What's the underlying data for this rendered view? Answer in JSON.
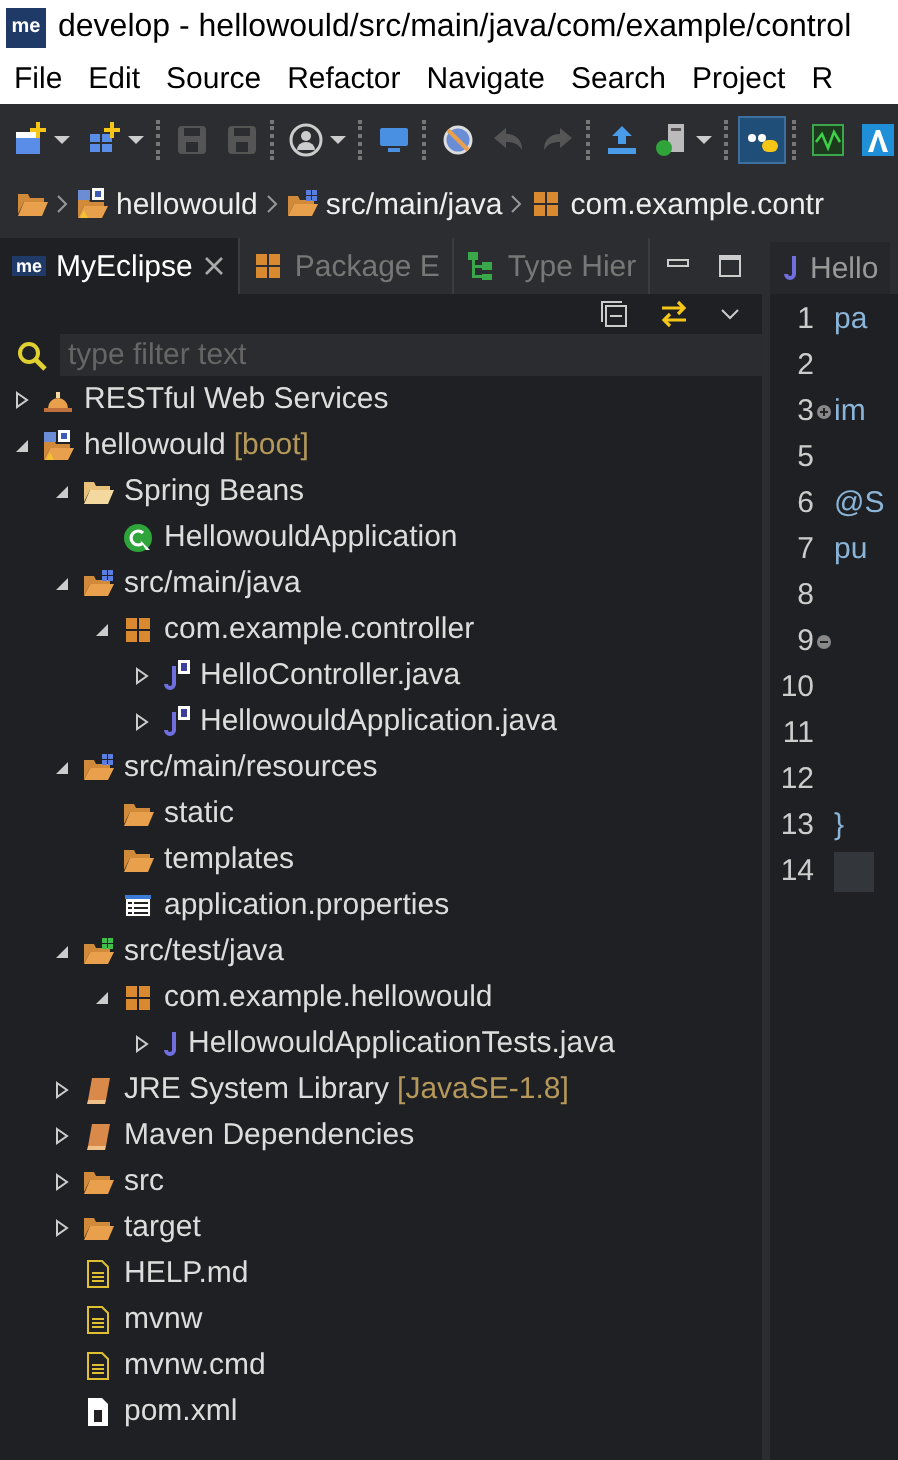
{
  "window": {
    "logo": "me",
    "title": "develop - hellowould/src/main/java/com/example/control"
  },
  "menu_bar": [
    "File",
    "Edit",
    "Source",
    "Refactor",
    "Navigate",
    "Search",
    "Project",
    "R"
  ],
  "toolbar": [
    {
      "kind": "new",
      "dropdown": true
    },
    {
      "kind": "new-class",
      "dropdown": true
    },
    {
      "kind": "sep"
    },
    {
      "kind": "save",
      "disabled": true
    },
    {
      "kind": "save-all",
      "disabled": true
    },
    {
      "kind": "sep"
    },
    {
      "kind": "user",
      "dropdown": true
    },
    {
      "kind": "sep"
    },
    {
      "kind": "monitor"
    },
    {
      "kind": "sep"
    },
    {
      "kind": "no-entry"
    },
    {
      "kind": "undo",
      "disabled": true
    },
    {
      "kind": "redo",
      "disabled": true
    },
    {
      "kind": "sep"
    },
    {
      "kind": "upload"
    },
    {
      "kind": "server",
      "dropdown": true
    },
    {
      "kind": "sep"
    },
    {
      "kind": "toggle",
      "selected": true
    },
    {
      "kind": "sep"
    },
    {
      "kind": "chart"
    },
    {
      "kind": "font"
    }
  ],
  "breadcrumb": [
    {
      "kind": "folder"
    },
    {
      "kind": "project",
      "label": "hellowould"
    },
    {
      "kind": "source-folder",
      "label": "src/main/java"
    },
    {
      "kind": "package",
      "label": "com.example.contr"
    }
  ],
  "views": {
    "tabs": [
      {
        "logo": "me",
        "label": "MyEclipse",
        "selected": true,
        "closable": true
      },
      {
        "kind": "package",
        "label": "Package E",
        "selected": false
      },
      {
        "kind": "hierarchy",
        "label": "Type Hier",
        "selected": false
      }
    ]
  },
  "filter": {
    "placeholder": "type filter text"
  },
  "tree": [
    {
      "kind": "service",
      "label": "RESTful Web Services",
      "expanded": false
    },
    {
      "kind": "project",
      "label": "hellowould",
      "decoration": "[boot]",
      "expanded": true,
      "children": [
        {
          "kind": "beans",
          "label": "Spring Beans",
          "expanded": true,
          "children": [
            {
              "kind": "spring-class",
              "label": "HellowouldApplication"
            }
          ]
        },
        {
          "kind": "source-folder",
          "label": "src/main/java",
          "expanded": true,
          "children": [
            {
              "kind": "package",
              "label": "com.example.controller",
              "expanded": true,
              "children": [
                {
                  "kind": "java-spring",
                  "label": "HelloController.java",
                  "expanded": false
                },
                {
                  "kind": "java-spring",
                  "label": "HellowouldApplication.java",
                  "expanded": false
                }
              ]
            }
          ]
        },
        {
          "kind": "source-folder",
          "label": "src/main/resources",
          "expanded": true,
          "children": [
            {
              "kind": "folder",
              "label": "static"
            },
            {
              "kind": "folder",
              "label": "templates"
            },
            {
              "kind": "properties",
              "label": "application.properties"
            }
          ]
        },
        {
          "kind": "test-folder",
          "label": "src/test/java",
          "expanded": true,
          "children": [
            {
              "kind": "package",
              "label": "com.example.hellowould",
              "expanded": true,
              "children": [
                {
                  "kind": "java",
                  "label": "HellowouldApplicationTests.java",
                  "expanded": false
                }
              ]
            }
          ]
        },
        {
          "kind": "library",
          "label": "JRE System Library",
          "decoration": "[JavaSE-1.8]",
          "expanded": false
        },
        {
          "kind": "library",
          "label": "Maven Dependencies",
          "expanded": false
        },
        {
          "kind": "folder",
          "label": "src",
          "expanded": false
        },
        {
          "kind": "folder",
          "label": "target",
          "expanded": false
        },
        {
          "kind": "text-file",
          "label": "HELP.md"
        },
        {
          "kind": "text-file",
          "label": "mvnw"
        },
        {
          "kind": "text-file",
          "label": "mvnw.cmd"
        },
        {
          "kind": "pom",
          "label": "pom.xml"
        }
      ]
    }
  ],
  "editor": {
    "tab": {
      "label": "Hello"
    },
    "lines": [
      {
        "number": "1",
        "code": "pa"
      },
      {
        "number": "2"
      },
      {
        "number": "3",
        "code": "im",
        "folded": true
      },
      {
        "number": "5"
      },
      {
        "number": "6",
        "code": "@S"
      },
      {
        "number": "7",
        "code": "pu"
      },
      {
        "number": "8"
      },
      {
        "number": "9",
        "folded": false
      },
      {
        "number": "10"
      },
      {
        "number": "11"
      },
      {
        "number": "12"
      },
      {
        "number": "13",
        "code": "}"
      },
      {
        "number": "14",
        "current": true
      }
    ]
  }
}
